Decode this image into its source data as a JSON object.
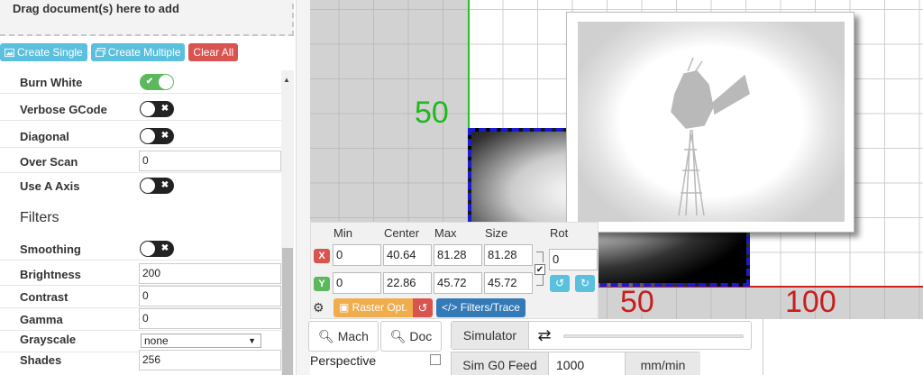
{
  "dropzone": {
    "label": "Drag document(s) here to add"
  },
  "toolbar": {
    "create_single": "Create Single",
    "create_multiple": "Create Multiple",
    "clear_all": "Clear All"
  },
  "settings": {
    "burn_white": {
      "label": "Burn White",
      "on": true
    },
    "verbose_gcode": {
      "label": "Verbose GCode",
      "on": false
    },
    "diagonal": {
      "label": "Diagonal",
      "on": false
    },
    "over_scan": {
      "label": "Over Scan",
      "value": "0"
    },
    "use_a_axis": {
      "label": "Use A Axis",
      "on": false
    }
  },
  "filters": {
    "heading": "Filters",
    "smoothing": {
      "label": "Smoothing",
      "on": false
    },
    "brightness": {
      "label": "Brightness",
      "value": "200"
    },
    "contrast": {
      "label": "Contrast",
      "value": "0"
    },
    "gamma": {
      "label": "Gamma",
      "value": "0"
    },
    "grayscale": {
      "label": "Grayscale",
      "value": "none"
    },
    "shades": {
      "label": "Shades",
      "value": "256"
    }
  },
  "viewer": {
    "y_axis_label": "50",
    "x_axis_labels": [
      "50",
      "100"
    ],
    "colors": {
      "y_axis": "#23c323",
      "x_axis": "#d02020",
      "selection": "#1a1ad0"
    }
  },
  "coords": {
    "headers": {
      "min": "Min",
      "center": "Center",
      "max": "Max",
      "size": "Size",
      "rot": "Rot"
    },
    "x": {
      "badge": "X",
      "min": "0",
      "center": "40.64",
      "max": "81.28",
      "size": "81.28"
    },
    "y": {
      "badge": "Y",
      "min": "0",
      "center": "22.86",
      "max": "45.72",
      "size": "45.72"
    },
    "rot": "0",
    "raster_btn": "Raster Opt.",
    "filters_btn": "Filters/Trace"
  },
  "bottom": {
    "mach_btn": "Mach",
    "doc_btn": "Doc",
    "simulator": "Simulator",
    "perspective": "Perspective",
    "sim_feed_label": "Sim G0 Feed",
    "sim_feed_value": "1000",
    "sim_feed_unit": "mm/min"
  },
  "icons": {
    "create_single": "image-icon",
    "create_multiple": "images-icon",
    "gear": "gear-icon",
    "search": "search-icon",
    "swap": "swap-arrows-icon"
  }
}
